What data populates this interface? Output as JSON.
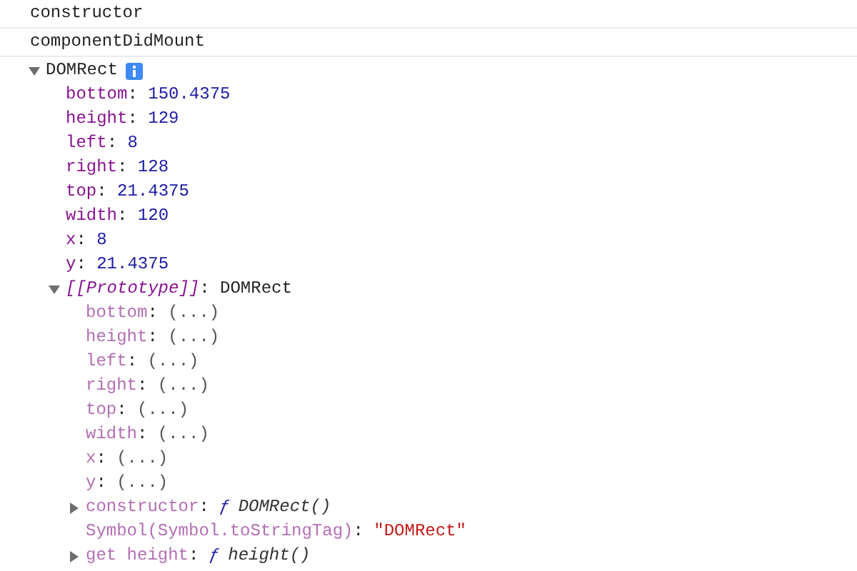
{
  "separator": ":",
  "log": [
    {
      "text": "constructor"
    },
    {
      "text": "componentDidMount"
    }
  ],
  "object": {
    "label": "DOMRect",
    "expanded": true,
    "children": [
      {
        "key": "bottom",
        "value": "150.4375",
        "kind": "number"
      },
      {
        "key": "height",
        "value": "129",
        "kind": "number"
      },
      {
        "key": "left",
        "value": "8",
        "kind": "number"
      },
      {
        "key": "right",
        "value": "128",
        "kind": "number"
      },
      {
        "key": "top",
        "value": "21.4375",
        "kind": "number"
      },
      {
        "key": "width",
        "value": "120",
        "kind": "number"
      },
      {
        "key": "x",
        "value": "8",
        "kind": "number"
      },
      {
        "key": "y",
        "value": "21.4375",
        "kind": "number"
      },
      {
        "key": "[[Prototype]]",
        "value": "DOMRect",
        "kind": "prototype",
        "expanded": true,
        "children": [
          {
            "key": "bottom",
            "value": "(...)",
            "kind": "getter"
          },
          {
            "key": "height",
            "value": "(...)",
            "kind": "getter"
          },
          {
            "key": "left",
            "value": "(...)",
            "kind": "getter"
          },
          {
            "key": "right",
            "value": "(...)",
            "kind": "getter"
          },
          {
            "key": "top",
            "value": "(...)",
            "kind": "getter"
          },
          {
            "key": "width",
            "value": "(...)",
            "kind": "getter"
          },
          {
            "key": "x",
            "value": "(...)",
            "kind": "getter"
          },
          {
            "key": "y",
            "value": "(...)",
            "kind": "getter"
          },
          {
            "key": "constructor",
            "prefix": "ƒ",
            "value": "DOMRect()",
            "kind": "function",
            "expanded": false
          },
          {
            "key": "Symbol(Symbol.toStringTag)",
            "value": "\"DOMRect\"",
            "kind": "string"
          },
          {
            "key": "get height",
            "prefix": "ƒ",
            "value": "height()",
            "kind": "function",
            "expanded": false
          }
        ]
      }
    ]
  }
}
